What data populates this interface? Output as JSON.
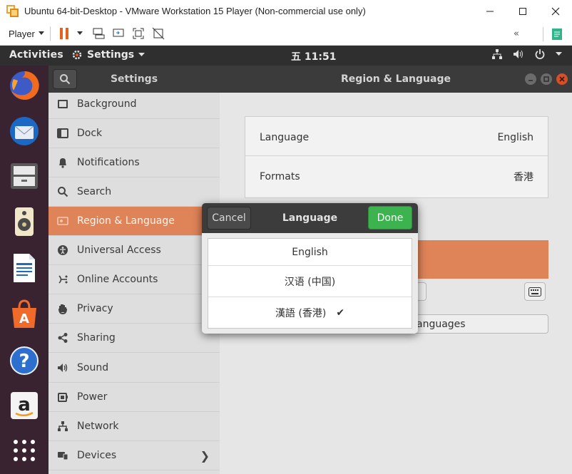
{
  "vm": {
    "title": "Ubuntu 64-bit-Desktop - VMware Workstation 15 Player (Non-commercial use only)",
    "player_menu": "Player",
    "window_controls": [
      "minimize-icon",
      "maximize-icon",
      "close-icon"
    ]
  },
  "topbar": {
    "activities": "Activities",
    "app_menu": "Settings",
    "clock": "五 11:51"
  },
  "dock": {
    "apps": [
      "firefox-icon",
      "thunderbird-icon",
      "files-icon",
      "rhythmbox-icon",
      "writer-icon",
      "software-icon",
      "help-icon",
      "amazon-icon"
    ],
    "show_apps": "show-applications-icon"
  },
  "settings": {
    "sidebar_title": "Settings",
    "panel_title": "Region & Language",
    "sidebar": [
      {
        "label": "Background",
        "icon": "background-icon"
      },
      {
        "label": "Dock",
        "icon": "dock-icon"
      },
      {
        "label": "Notifications",
        "icon": "bell-icon"
      },
      {
        "label": "Search",
        "icon": "search-icon"
      },
      {
        "label": "Region & Language",
        "icon": "region-icon"
      },
      {
        "label": "Universal Access",
        "icon": "accessibility-icon"
      },
      {
        "label": "Online Accounts",
        "icon": "online-accounts-icon"
      },
      {
        "label": "Privacy",
        "icon": "hand-icon"
      },
      {
        "label": "Sharing",
        "icon": "share-icon"
      },
      {
        "label": "Sound",
        "icon": "speaker-icon"
      },
      {
        "label": "Power",
        "icon": "power-icon"
      },
      {
        "label": "Network",
        "icon": "network-icon"
      },
      {
        "label": "Devices",
        "icon": "devices-icon"
      }
    ],
    "active_item": "Region & Language",
    "language_row": {
      "label": "Language",
      "value": "English"
    },
    "formats_row": {
      "label": "Formats",
      "value": "香港"
    },
    "manage_button": "anguages"
  },
  "dialog": {
    "title": "Language",
    "cancel": "Cancel",
    "done": "Done",
    "options": [
      "English",
      "汉语 (中国)",
      "漢語 (香港)"
    ],
    "selected": "漢語 (香港)"
  },
  "colors": {
    "accent": "#df8358",
    "done_green": "#3db34f",
    "header_dark": "#3b3b3b",
    "dock_bg": "#3a2330"
  }
}
